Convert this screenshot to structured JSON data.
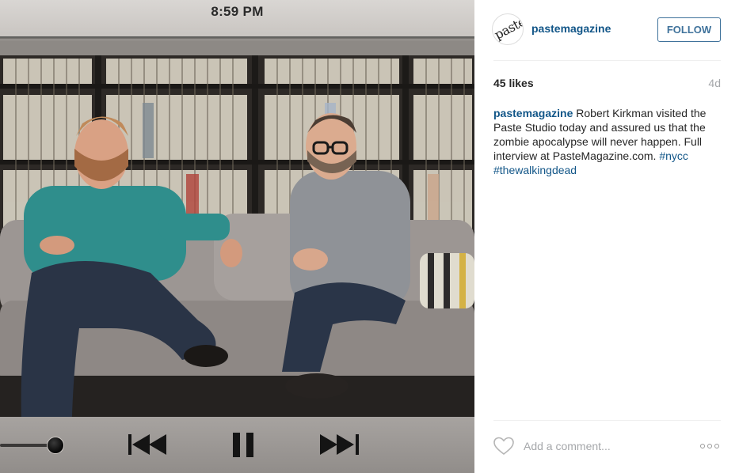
{
  "status_bar": {
    "time": "8:59 PM"
  },
  "player": {
    "controls": [
      {
        "name": "previous-icon"
      },
      {
        "name": "pause-icon"
      },
      {
        "name": "next-icon"
      }
    ],
    "progress": 0.12
  },
  "post": {
    "avatar_text": "paste",
    "username": "pastemagazine",
    "follow_label": "FOLLOW",
    "likes": "45 likes",
    "time_ago": "4d",
    "caption": {
      "username": "pastemagazine",
      "text": "Robert Kirkman visited the Paste Studio today and assured us that the zombie apocalypse will never happen. Full interview at PasteMagazine.com.",
      "hashtags": [
        "#nycc",
        "#thewalkingdead"
      ]
    },
    "comment_placeholder": "Add a comment...",
    "icons": {
      "like": "heart-icon",
      "more": "more-options-icon"
    }
  },
  "colors": {
    "link": "#125688",
    "follow": "#3f729b",
    "muted": "#a5a7aa",
    "text": "#262626"
  }
}
